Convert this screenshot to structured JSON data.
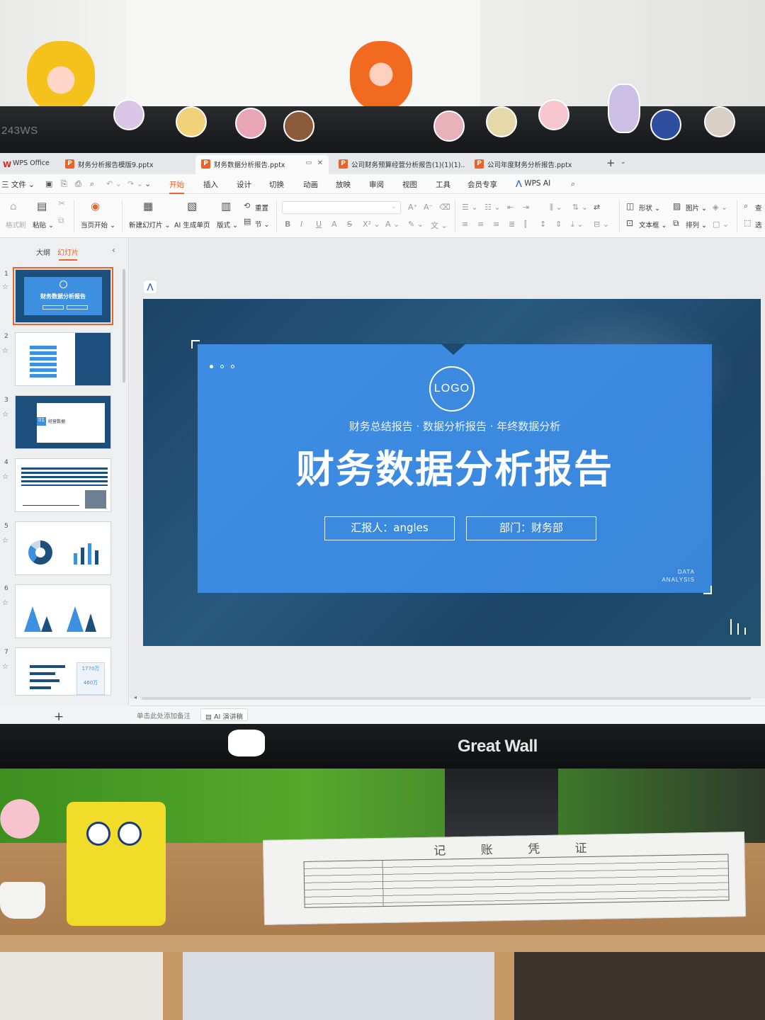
{
  "bezel": {
    "label": "243WS",
    "brand": "Great Wall"
  },
  "paper": {
    "title": "记 账 凭 证"
  },
  "tabs": [
    {
      "label": "WPS Office",
      "kind": "home"
    },
    {
      "label": "财务分析报告模版9.pptx",
      "kind": "pptx"
    },
    {
      "label": "财务数据分析报告.pptx",
      "kind": "pptx",
      "active": true
    },
    {
      "label": "公司财务预算经营分析报告(1)(1)(1)...",
      "kind": "pptx"
    },
    {
      "label": "公司年度财务分析报告.pptx",
      "kind": "pptx"
    }
  ],
  "menu": {
    "file": "三 文件 ⌄",
    "items": [
      "开始",
      "插入",
      "设计",
      "切换",
      "动画",
      "放映",
      "审阅",
      "视图",
      "工具",
      "会员专享"
    ],
    "active": "开始",
    "wps_ai": "WPS AI"
  },
  "ribbon": {
    "format_painter": "格式刷",
    "paste": "粘贴 ⌄",
    "from_current": "当页开始 ⌄",
    "new_slide": "新建幻灯片 ⌄",
    "ai_page": "AI 生成单页",
    "layout": "版式 ⌄",
    "reset": "重置",
    "section": "节 ⌄",
    "shape": "形状 ⌄",
    "picture": "图片 ⌄",
    "textbox": "文本框 ⌄",
    "arrange": "排列 ⌄",
    "find": "查",
    "select": "选"
  },
  "left_panel": {
    "tab_outline": "大纲",
    "tab_slides": "幻灯片",
    "slides": [
      {
        "num": "1",
        "title": "财务数据分析报告"
      },
      {
        "num": "2"
      },
      {
        "num": "3",
        "chapter_num": "01",
        "chapter_title": "经营数据"
      },
      {
        "num": "4"
      },
      {
        "num": "5"
      },
      {
        "num": "6"
      },
      {
        "num": "7",
        "big_value": "1770万",
        "small_value": "460万"
      }
    ]
  },
  "slide": {
    "logo": "LOGO",
    "subtitle": "财务总结报告 · 数据分析报告 · 年终数据分析",
    "title": "财务数据分析报告",
    "reporter": "汇报人：angles",
    "department": "部门：财务部",
    "tag_line1": "DATA",
    "tag_line2": "ANALYSIS"
  },
  "notes": {
    "placeholder": "单击此处添加备注",
    "ai_button": "AI 演讲稿"
  },
  "colors": {
    "accent": "#e8642b",
    "slide_bg": "#1d4a70",
    "card": "#3b8ae0"
  }
}
